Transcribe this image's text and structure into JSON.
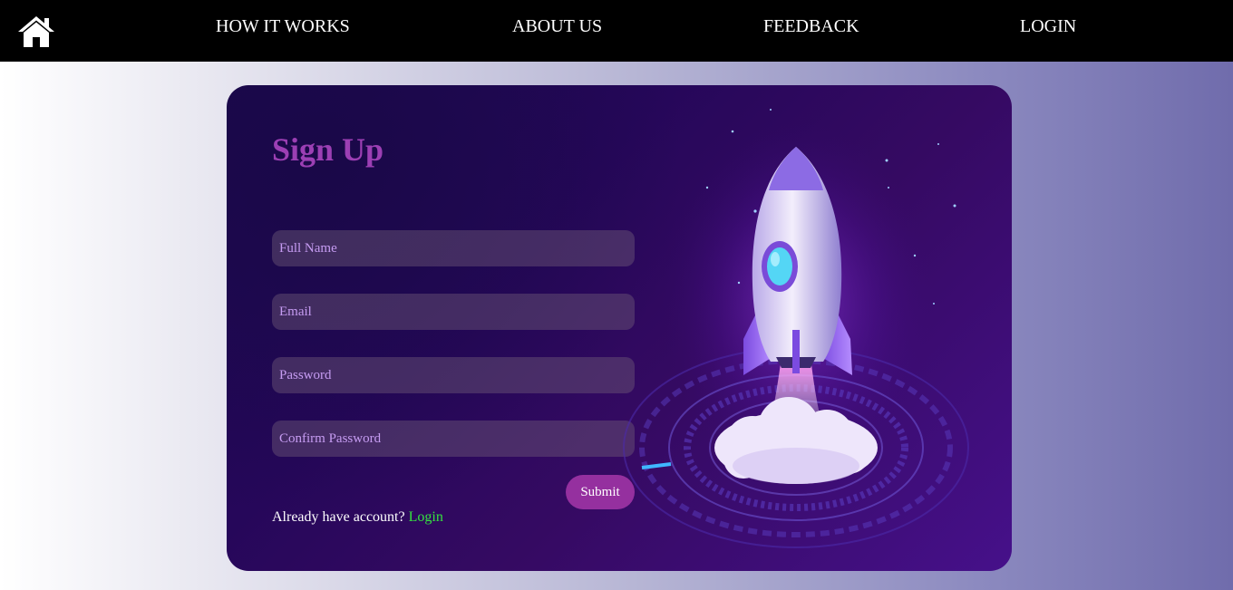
{
  "nav": {
    "home_icon": "home-icon",
    "links": [
      "HOW IT WORKS",
      "ABOUT US",
      "FEEDBACK",
      "LOGIN"
    ]
  },
  "signup": {
    "title": "Sign Up",
    "fields": {
      "full_name_placeholder": "Full Name",
      "email_placeholder": "Email",
      "password_placeholder": "Password",
      "confirm_password_placeholder": "Confirm Password"
    },
    "submit_label": "Submit",
    "already_text": "Already have account?",
    "login_link": "Login"
  },
  "colors": {
    "nav_bg": "#000000",
    "card_bg": "#26075a",
    "title": "#9c3fb4",
    "submit_bg": "#95309f",
    "login_link": "#35e23f",
    "field_text": "#c69cf2"
  },
  "illustration": "rocket-launch-illustration"
}
